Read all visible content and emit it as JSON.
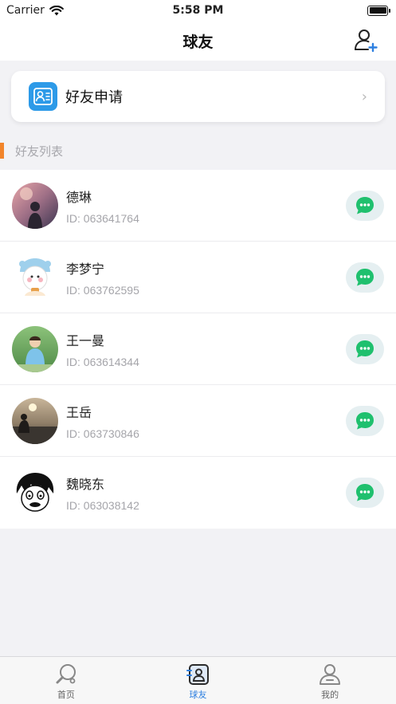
{
  "status_bar": {
    "carrier": "Carrier",
    "time": "5:58 PM"
  },
  "nav": {
    "title": "球友"
  },
  "friend_request": {
    "label": "好友申请"
  },
  "section": {
    "title": "好友列表"
  },
  "friends": [
    {
      "name": "德琳",
      "id": "ID: 063641764"
    },
    {
      "name": "李梦宁",
      "id": "ID: 063762595"
    },
    {
      "name": "王一曼",
      "id": "ID: 063614344"
    },
    {
      "name": "王岳",
      "id": "ID: 063730846"
    },
    {
      "name": "魏晓东",
      "id": "ID: 063038142"
    }
  ],
  "tabs": [
    {
      "label": "首页"
    },
    {
      "label": "球友"
    },
    {
      "label": "我的"
    }
  ],
  "colors": {
    "accent": "#2d7fe0",
    "chat_green": "#1fc06e",
    "section_accent": "#f2852b",
    "request_icon_bg": "#2d9ae8"
  }
}
